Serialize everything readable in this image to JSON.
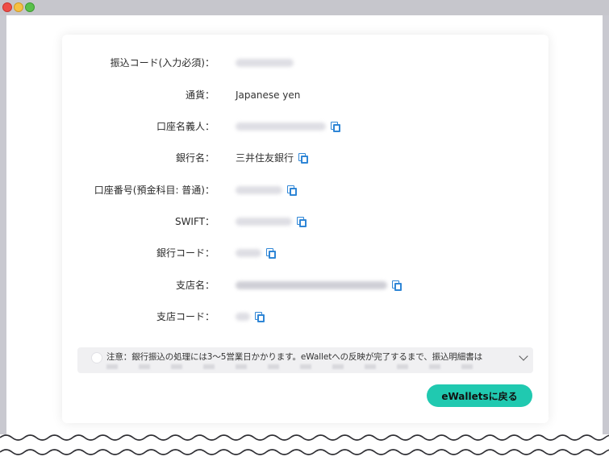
{
  "rows": [
    {
      "label": "振込コード(入力必須)：",
      "value": "",
      "blur_w": 72,
      "copy": false
    },
    {
      "label": "通貨：",
      "value": "Japanese yen",
      "blur_w": 0,
      "copy": false
    },
    {
      "label": "口座名義人：",
      "value": "",
      "blur_w": 112,
      "copy": true
    },
    {
      "label": "銀行名：",
      "value": "三井住友銀行",
      "blur_w": 0,
      "copy": true
    },
    {
      "label": "口座番号(預金科目: 普通)：",
      "value": "",
      "blur_w": 58,
      "copy": true
    },
    {
      "label": "SWIFT：",
      "value": "",
      "blur_w": 70,
      "copy": true
    },
    {
      "label": "銀行コード：",
      "value": "",
      "blur_w": 32,
      "copy": true
    },
    {
      "label": "支店名：",
      "value": "",
      "blur_w": 188,
      "copy": true
    },
    {
      "label": "支店コード：",
      "value": "",
      "blur_w": 18,
      "copy": true
    }
  ],
  "notice": {
    "text": "注意：銀行振込の処理には3～5営業日かかります。eWalletへの反映が完了するまで、振込明細書は"
  },
  "back_button": {
    "label": "eWalletsに戻る"
  }
}
